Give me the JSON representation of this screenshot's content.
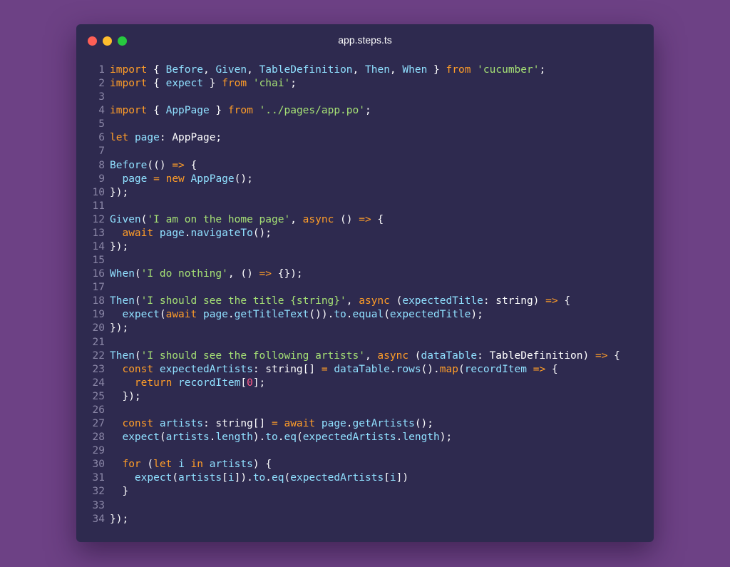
{
  "window": {
    "title": "app.steps.ts"
  },
  "colors": {
    "background": "#6d4185",
    "editor_bg": "#2e2a4f",
    "keyword": "#ff9d28",
    "string": "#a5e075",
    "identifier": "#90e0ff",
    "number": "#ff5c8a",
    "plain": "#ffffff",
    "line_number": "#8a86a6"
  },
  "code_lines": [
    {
      "n": "1",
      "t": [
        [
          "k",
          "import"
        ],
        [
          "p",
          " { "
        ],
        [
          "f",
          "Before"
        ],
        [
          "p",
          ", "
        ],
        [
          "f",
          "Given"
        ],
        [
          "p",
          ", "
        ],
        [
          "f",
          "TableDefinition"
        ],
        [
          "p",
          ", "
        ],
        [
          "f",
          "Then"
        ],
        [
          "p",
          ", "
        ],
        [
          "f",
          "When"
        ],
        [
          "p",
          " } "
        ],
        [
          "k",
          "from"
        ],
        [
          "p",
          " "
        ],
        [
          "s",
          "'cucumber'"
        ],
        [
          "p",
          ";"
        ]
      ]
    },
    {
      "n": "2",
      "t": [
        [
          "k",
          "import"
        ],
        [
          "p",
          " { "
        ],
        [
          "f",
          "expect"
        ],
        [
          "p",
          " } "
        ],
        [
          "k",
          "from"
        ],
        [
          "p",
          " "
        ],
        [
          "s",
          "'chai'"
        ],
        [
          "p",
          ";"
        ]
      ]
    },
    {
      "n": "3",
      "t": []
    },
    {
      "n": "4",
      "t": [
        [
          "k",
          "import"
        ],
        [
          "p",
          " { "
        ],
        [
          "f",
          "AppPage"
        ],
        [
          "p",
          " } "
        ],
        [
          "k",
          "from"
        ],
        [
          "p",
          " "
        ],
        [
          "s",
          "'../pages/app.po'"
        ],
        [
          "p",
          ";"
        ]
      ]
    },
    {
      "n": "5",
      "t": []
    },
    {
      "n": "6",
      "t": [
        [
          "k",
          "let"
        ],
        [
          "p",
          " "
        ],
        [
          "f",
          "page"
        ],
        [
          "p",
          ": AppPage;"
        ]
      ]
    },
    {
      "n": "7",
      "t": []
    },
    {
      "n": "8",
      "t": [
        [
          "f",
          "Before"
        ],
        [
          "p",
          "(() "
        ],
        [
          "k",
          "=>"
        ],
        [
          "p",
          " {"
        ]
      ]
    },
    {
      "n": "9",
      "t": [
        [
          "p",
          "  "
        ],
        [
          "f",
          "page"
        ],
        [
          "p",
          " "
        ],
        [
          "k",
          "="
        ],
        [
          "p",
          " "
        ],
        [
          "k",
          "new"
        ],
        [
          "p",
          " "
        ],
        [
          "f",
          "AppPage"
        ],
        [
          "p",
          "();"
        ]
      ]
    },
    {
      "n": "10",
      "t": [
        [
          "p",
          "});"
        ]
      ]
    },
    {
      "n": "11",
      "t": []
    },
    {
      "n": "12",
      "t": [
        [
          "f",
          "Given"
        ],
        [
          "p",
          "("
        ],
        [
          "s",
          "'I am on the home page'"
        ],
        [
          "p",
          ", "
        ],
        [
          "k",
          "async"
        ],
        [
          "p",
          " () "
        ],
        [
          "k",
          "=>"
        ],
        [
          "p",
          " {"
        ]
      ]
    },
    {
      "n": "13",
      "t": [
        [
          "p",
          "  "
        ],
        [
          "k",
          "await"
        ],
        [
          "p",
          " "
        ],
        [
          "f",
          "page"
        ],
        [
          "p",
          "."
        ],
        [
          "f",
          "navigateTo"
        ],
        [
          "p",
          "();"
        ]
      ]
    },
    {
      "n": "14",
      "t": [
        [
          "p",
          "});"
        ]
      ]
    },
    {
      "n": "15",
      "t": []
    },
    {
      "n": "16",
      "t": [
        [
          "f",
          "When"
        ],
        [
          "p",
          "("
        ],
        [
          "s",
          "'I do nothing'"
        ],
        [
          "p",
          ", () "
        ],
        [
          "k",
          "=>"
        ],
        [
          "p",
          " {});"
        ]
      ]
    },
    {
      "n": "17",
      "t": []
    },
    {
      "n": "18",
      "t": [
        [
          "f",
          "Then"
        ],
        [
          "p",
          "("
        ],
        [
          "s",
          "'I should see the title {string}'"
        ],
        [
          "p",
          ", "
        ],
        [
          "k",
          "async"
        ],
        [
          "p",
          " ("
        ],
        [
          "f",
          "expectedTitle"
        ],
        [
          "p",
          ": string) "
        ],
        [
          "k",
          "=>"
        ],
        [
          "p",
          " {"
        ]
      ]
    },
    {
      "n": "19",
      "t": [
        [
          "p",
          "  "
        ],
        [
          "f",
          "expect"
        ],
        [
          "p",
          "("
        ],
        [
          "k",
          "await"
        ],
        [
          "p",
          " "
        ],
        [
          "f",
          "page"
        ],
        [
          "p",
          "."
        ],
        [
          "f",
          "getTitleText"
        ],
        [
          "p",
          "())."
        ],
        [
          "f",
          "to"
        ],
        [
          "p",
          "."
        ],
        [
          "f",
          "equal"
        ],
        [
          "p",
          "("
        ],
        [
          "f",
          "expectedTitle"
        ],
        [
          "p",
          ");"
        ]
      ]
    },
    {
      "n": "20",
      "t": [
        [
          "p",
          "});"
        ]
      ]
    },
    {
      "n": "21",
      "t": []
    },
    {
      "n": "22",
      "t": [
        [
          "f",
          "Then"
        ],
        [
          "p",
          "("
        ],
        [
          "s",
          "'I should see the following artists'"
        ],
        [
          "p",
          ", "
        ],
        [
          "k",
          "async"
        ],
        [
          "p",
          " ("
        ],
        [
          "f",
          "dataTable"
        ],
        [
          "p",
          ": TableDefinition) "
        ],
        [
          "k",
          "=>"
        ],
        [
          "p",
          " {"
        ]
      ]
    },
    {
      "n": "23",
      "t": [
        [
          "p",
          "  "
        ],
        [
          "k",
          "const"
        ],
        [
          "p",
          " "
        ],
        [
          "f",
          "expectedArtists"
        ],
        [
          "p",
          ": string[] "
        ],
        [
          "k",
          "="
        ],
        [
          "p",
          " "
        ],
        [
          "f",
          "dataTable"
        ],
        [
          "p",
          "."
        ],
        [
          "f",
          "rows"
        ],
        [
          "p",
          "()."
        ],
        [
          "k",
          "map"
        ],
        [
          "p",
          "("
        ],
        [
          "f",
          "recordItem"
        ],
        [
          "p",
          " "
        ],
        [
          "k",
          "=>"
        ],
        [
          "p",
          " {"
        ]
      ]
    },
    {
      "n": "24",
      "t": [
        [
          "p",
          "    "
        ],
        [
          "k",
          "return"
        ],
        [
          "p",
          " "
        ],
        [
          "f",
          "recordItem"
        ],
        [
          "p",
          "["
        ],
        [
          "n",
          "0"
        ],
        [
          "p",
          "];"
        ]
      ]
    },
    {
      "n": "25",
      "t": [
        [
          "p",
          "  });"
        ]
      ]
    },
    {
      "n": "26",
      "t": []
    },
    {
      "n": "27",
      "t": [
        [
          "p",
          "  "
        ],
        [
          "k",
          "const"
        ],
        [
          "p",
          " "
        ],
        [
          "f",
          "artists"
        ],
        [
          "p",
          ": string[] "
        ],
        [
          "k",
          "="
        ],
        [
          "p",
          " "
        ],
        [
          "k",
          "await"
        ],
        [
          "p",
          " "
        ],
        [
          "f",
          "page"
        ],
        [
          "p",
          "."
        ],
        [
          "f",
          "getArtists"
        ],
        [
          "p",
          "();"
        ]
      ]
    },
    {
      "n": "28",
      "t": [
        [
          "p",
          "  "
        ],
        [
          "f",
          "expect"
        ],
        [
          "p",
          "("
        ],
        [
          "f",
          "artists"
        ],
        [
          "p",
          "."
        ],
        [
          "f",
          "length"
        ],
        [
          "p",
          ")."
        ],
        [
          "f",
          "to"
        ],
        [
          "p",
          "."
        ],
        [
          "f",
          "eq"
        ],
        [
          "p",
          "("
        ],
        [
          "f",
          "expectedArtists"
        ],
        [
          "p",
          "."
        ],
        [
          "f",
          "length"
        ],
        [
          "p",
          ");"
        ]
      ]
    },
    {
      "n": "29",
      "t": []
    },
    {
      "n": "30",
      "t": [
        [
          "p",
          "  "
        ],
        [
          "k",
          "for"
        ],
        [
          "p",
          " ("
        ],
        [
          "k",
          "let"
        ],
        [
          "p",
          " "
        ],
        [
          "f",
          "i"
        ],
        [
          "p",
          " "
        ],
        [
          "k",
          "in"
        ],
        [
          "p",
          " "
        ],
        [
          "f",
          "artists"
        ],
        [
          "p",
          ") {"
        ]
      ]
    },
    {
      "n": "31",
      "t": [
        [
          "p",
          "    "
        ],
        [
          "f",
          "expect"
        ],
        [
          "p",
          "("
        ],
        [
          "f",
          "artists"
        ],
        [
          "p",
          "["
        ],
        [
          "f",
          "i"
        ],
        [
          "p",
          "])."
        ],
        [
          "f",
          "to"
        ],
        [
          "p",
          "."
        ],
        [
          "f",
          "eq"
        ],
        [
          "p",
          "("
        ],
        [
          "f",
          "expectedArtists"
        ],
        [
          "p",
          "["
        ],
        [
          "f",
          "i"
        ],
        [
          "p",
          "])"
        ]
      ]
    },
    {
      "n": "32",
      "t": [
        [
          "p",
          "  }"
        ]
      ]
    },
    {
      "n": "33",
      "t": []
    },
    {
      "n": "34",
      "t": [
        [
          "p",
          "});"
        ]
      ]
    }
  ]
}
